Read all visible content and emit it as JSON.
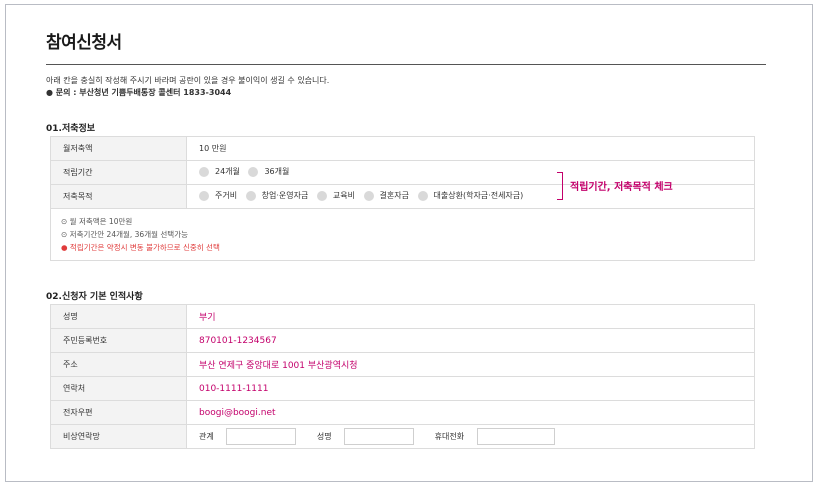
{
  "title": "참여신청서",
  "notice": {
    "line1": "아래 칸을 충실히 작성해 주시기 바라며 공란이 있을 경우 불이익이 생길 수 있습니다.",
    "line2": "● 문의 : 부산청년 기쁨두배통장 콜센터 1833-3044"
  },
  "savings": {
    "section_title": "01.저축정보",
    "monthly_label": "월저축액",
    "monthly_value": "10 만원",
    "period_label": "적립기간",
    "period_options": [
      "24개월",
      "36개월"
    ],
    "purpose_label": "저축목적",
    "purpose_options": [
      "주거비",
      "창업·운영자금",
      "교육비",
      "결혼자금",
      "대출상환(학자금·전세자금)"
    ],
    "notes": [
      "⊙ 월 저축액은 10만원",
      "⊙ 저축기간안 24개월, 36개월 선택가능",
      "● 적립기간은 약정시 변동 불가하므로 신중히 선택"
    ],
    "annotation": "적립기간, 저축목적 체크"
  },
  "applicant": {
    "section_title": "02.신청자 기본 인적사항",
    "rows": [
      {
        "label": "성명",
        "value": "부기"
      },
      {
        "label": "주민등록번호",
        "value": "870101-1234567"
      },
      {
        "label": "주소",
        "value": "부산 연제구 중앙대로 1001 부산광역시청"
      },
      {
        "label": "연락처",
        "value": "010-1111-1111"
      },
      {
        "label": "전자우편",
        "value": "boogi@boogi.net"
      }
    ],
    "emergency": {
      "label": "비상연락망",
      "relation_label": "관계",
      "name_label": "성명",
      "phone_label": "휴대전화",
      "relation_value": "",
      "name_value": "",
      "phone_value": ""
    }
  },
  "colors": {
    "accent": "#c3006b",
    "warning": "#e03c3c",
    "label_bg": "#f3f3f3"
  }
}
